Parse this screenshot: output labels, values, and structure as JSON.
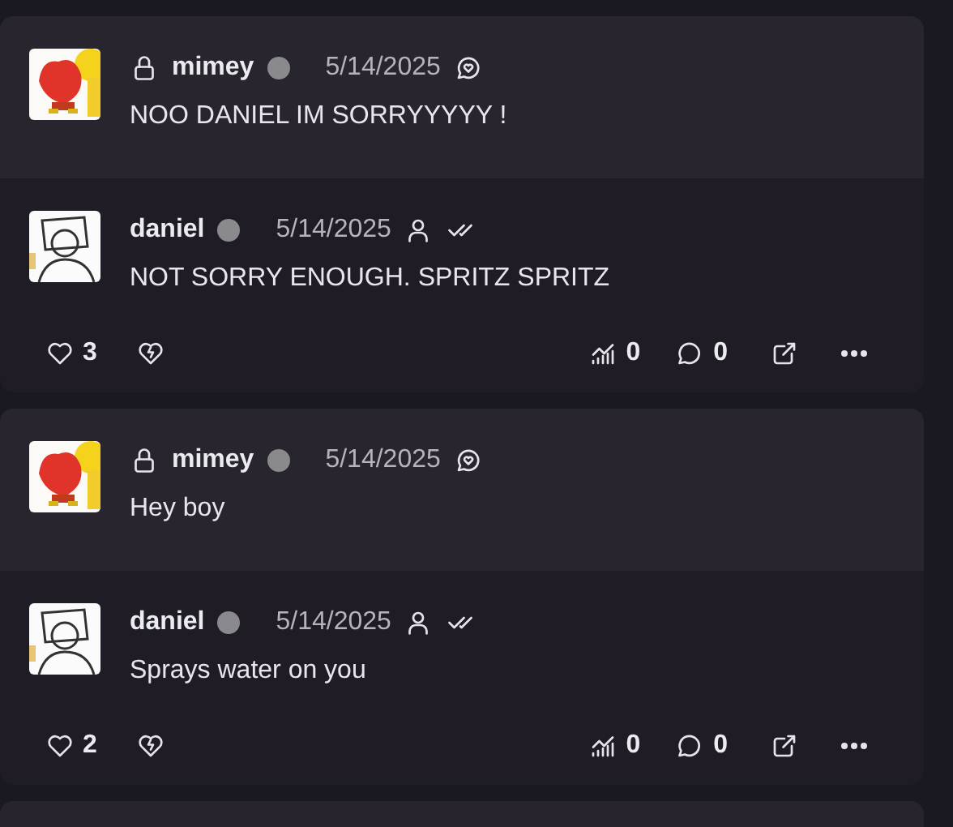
{
  "posts": [
    {
      "quote": {
        "author": "mimey",
        "locked": true,
        "date": "5/14/2025",
        "text": "NOO DANIEL IM SORRYYYYY !"
      },
      "reply": {
        "author": "daniel",
        "date": "5/14/2025",
        "text": "NOT SORRY ENOUGH. SPRITZ SPRITZ",
        "likes": "3",
        "views": "0",
        "comments": "0"
      }
    },
    {
      "quote": {
        "author": "mimey",
        "locked": true,
        "date": "5/14/2025",
        "text": "Hey boy"
      },
      "reply": {
        "author": "daniel",
        "date": "5/14/2025",
        "text": "Sprays water on you",
        "likes": "2",
        "views": "0",
        "comments": "0"
      }
    }
  ]
}
